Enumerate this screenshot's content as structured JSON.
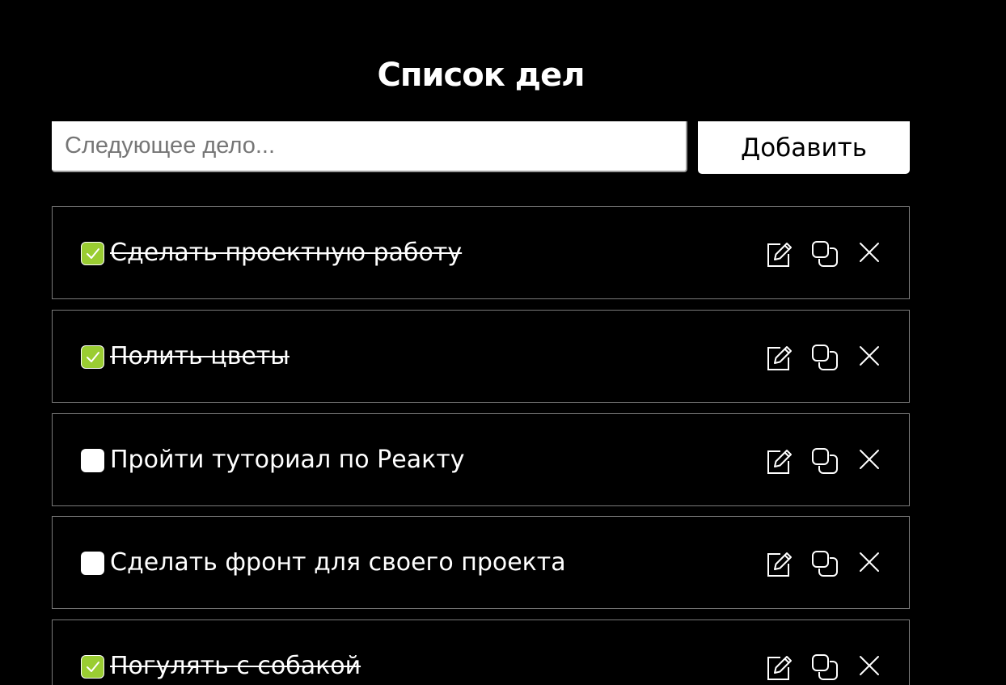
{
  "app": {
    "title": "Список дел"
  },
  "new_task": {
    "placeholder": "Следующее дело...",
    "value": "",
    "add_label": "Добавить"
  },
  "colors": {
    "background": "#000000",
    "check_accent": "#9acd32",
    "text": "#ffffff"
  },
  "tasks": [
    {
      "text": "Сделать проектную работу",
      "done": true
    },
    {
      "text": "Полить цветы",
      "done": true
    },
    {
      "text": "Пройти туториал по Реакту",
      "done": false
    },
    {
      "text": "Сделать фронт для своего проекта",
      "done": false
    },
    {
      "text": "Погулять с собакой",
      "done": true
    }
  ],
  "task_actions": {
    "edit_icon": "edit-icon",
    "copy_icon": "copy-icon",
    "delete_icon": "close-icon"
  }
}
